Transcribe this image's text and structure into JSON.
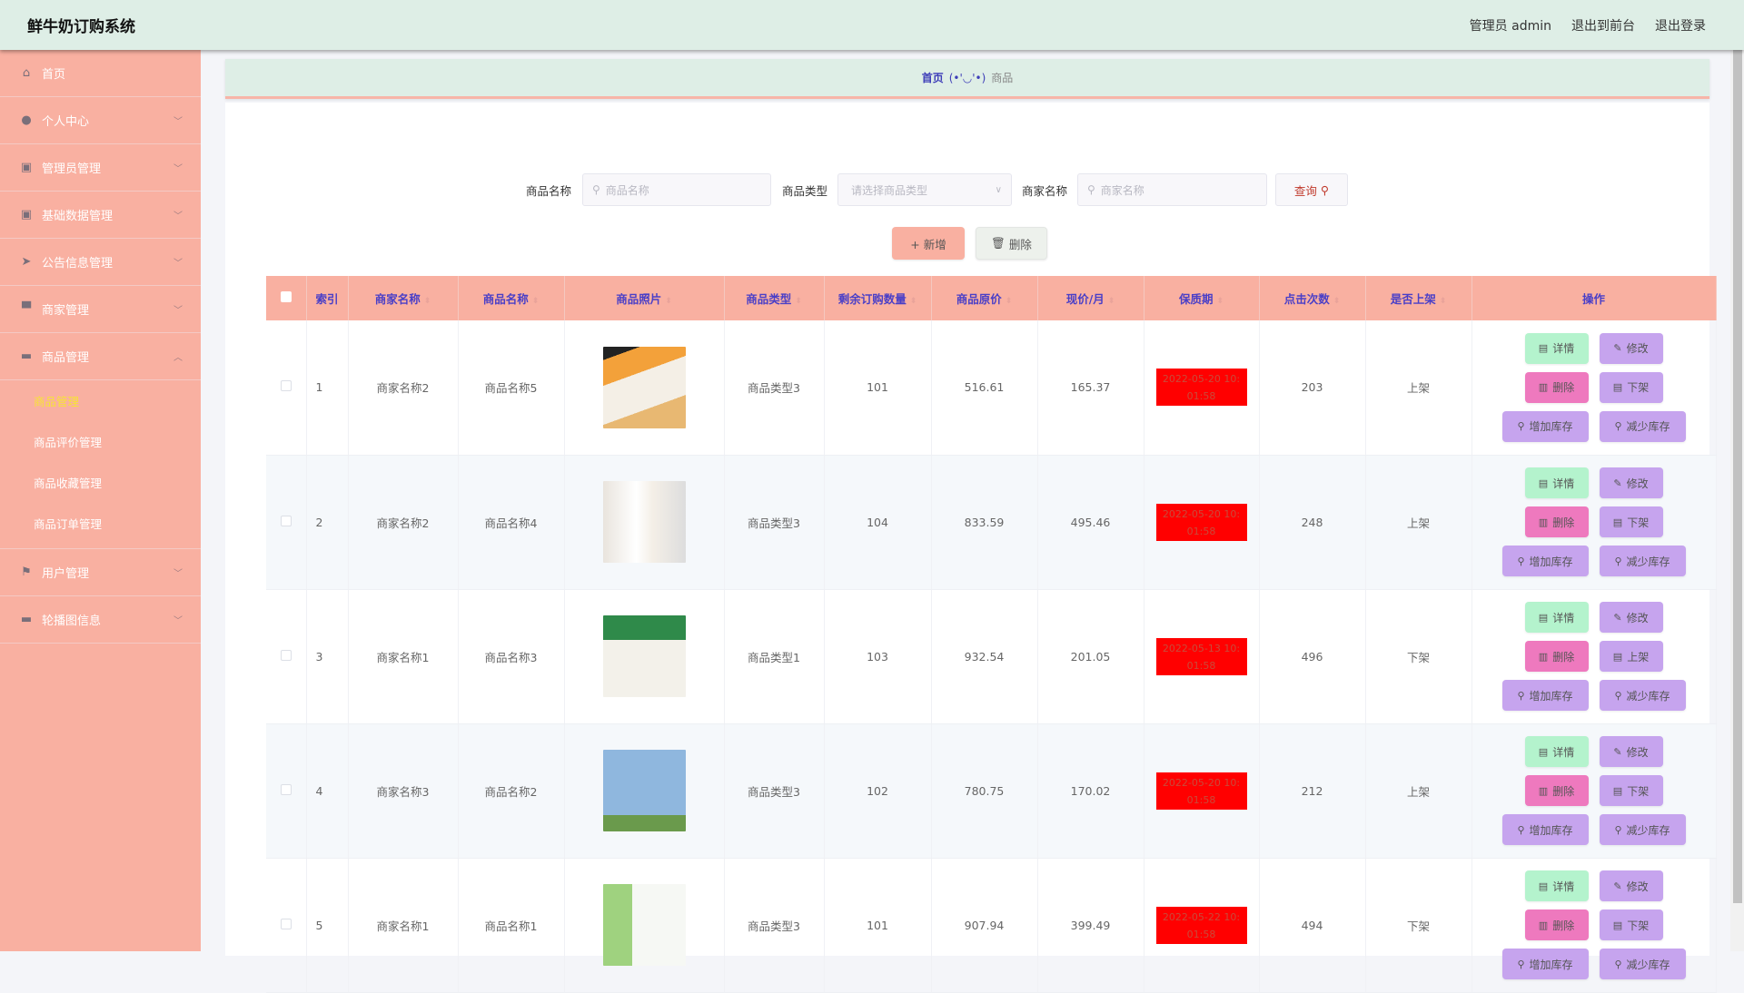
{
  "header": {
    "title": "鲜牛奶订购系统",
    "user": "管理员 admin",
    "to_front": "退出到前台",
    "logout": "退出登录"
  },
  "sidebar": {
    "items": [
      {
        "label": "首页",
        "icon": "home-icon",
        "glyph": "⌂"
      },
      {
        "label": "个人中心",
        "icon": "user-icon",
        "glyph": "●",
        "chev": "﹀"
      },
      {
        "label": "管理员管理",
        "icon": "clipboard-icon",
        "glyph": "▣",
        "chev": "﹀"
      },
      {
        "label": "基础数据管理",
        "icon": "clipboard-check-icon",
        "glyph": "▣",
        "chev": "﹀"
      },
      {
        "label": "公告信息管理",
        "icon": "paper-plane-icon",
        "glyph": "➤",
        "chev": "﹀"
      },
      {
        "label": "商家管理",
        "icon": "shop-sign-icon",
        "glyph": "▀",
        "chev": "﹀"
      },
      {
        "label": "商品管理",
        "icon": "monitor-icon",
        "glyph": "▬",
        "chev": "︿"
      }
    ],
    "sub_items": [
      {
        "label": "商品管理",
        "active": true
      },
      {
        "label": "商品评价管理"
      },
      {
        "label": "商品收藏管理"
      },
      {
        "label": "商品订单管理"
      }
    ],
    "items_after": [
      {
        "label": "用户管理",
        "icon": "flag-icon",
        "glyph": "⚑",
        "chev": "﹀"
      },
      {
        "label": "轮播图信息",
        "icon": "briefcase-icon",
        "glyph": "▬",
        "chev": "﹀"
      }
    ]
  },
  "breadcrumb": {
    "home": "首页",
    "face": "(•'◡'•)",
    "current": "商品"
  },
  "search": {
    "name_label": "商品名称",
    "name_placeholder": "商品名称",
    "type_label": "商品类型",
    "type_placeholder": "请选择商品类型",
    "shop_label": "商家名称",
    "shop_placeholder": "商家名称",
    "query": "查询"
  },
  "actions": {
    "add": "+ 新增",
    "delete": "删除"
  },
  "table": {
    "columns": [
      "索引",
      "商家名称",
      "商品名称",
      "商品照片",
      "商品类型",
      "剩余订购数量",
      "商品原价",
      "现价/月",
      "保质期",
      "点击次数",
      "是否上架",
      "操作"
    ],
    "rows": [
      {
        "index": "1",
        "shop": "商家名称2",
        "name": "商品名称5",
        "type": "商品类型3",
        "remaining": "101",
        "price": "516.61",
        "monthly": "165.37",
        "expiry": [
          "2022-05-20 10:",
          "01:58"
        ],
        "clicks": "203",
        "listed": "上架",
        "toggle": "下架"
      },
      {
        "index": "2",
        "shop": "商家名称2",
        "name": "商品名称4",
        "type": "商品类型3",
        "remaining": "104",
        "price": "833.59",
        "monthly": "495.46",
        "expiry": [
          "2022-05-20 10:",
          "01:58"
        ],
        "clicks": "248",
        "listed": "上架",
        "toggle": "下架"
      },
      {
        "index": "3",
        "shop": "商家名称1",
        "name": "商品名称3",
        "type": "商品类型1",
        "remaining": "103",
        "price": "932.54",
        "monthly": "201.05",
        "expiry": [
          "2022-05-13 10:",
          "01:58"
        ],
        "clicks": "496",
        "listed": "下架",
        "toggle": "上架"
      },
      {
        "index": "4",
        "shop": "商家名称3",
        "name": "商品名称2",
        "type": "商品类型3",
        "remaining": "102",
        "price": "780.75",
        "monthly": "170.02",
        "expiry": [
          "2022-05-20 10:",
          "01:58"
        ],
        "clicks": "212",
        "listed": "上架",
        "toggle": "下架"
      },
      {
        "index": "5",
        "shop": "商家名称1",
        "name": "商品名称1",
        "type": "商品类型3",
        "remaining": "101",
        "price": "907.94",
        "monthly": "399.49",
        "expiry": [
          "2022-05-22 10:",
          "01:58"
        ],
        "clicks": "494",
        "listed": "下架",
        "toggle": "下架"
      }
    ],
    "op_labels": {
      "detail": "详情",
      "edit": "修改",
      "delete": "删除",
      "add_stock": "增加库存",
      "reduce_stock": "减少库存"
    }
  },
  "colors": {
    "header_bg": "#deeee6",
    "sidebar_bg": "#f9b0a1",
    "header_text": "#4a3fc7",
    "expiry_bg": "#ff0000",
    "detail_btn": "#b4f3cd",
    "edit_btn": "#c6a4ee",
    "delete_btn": "#ee79be"
  }
}
